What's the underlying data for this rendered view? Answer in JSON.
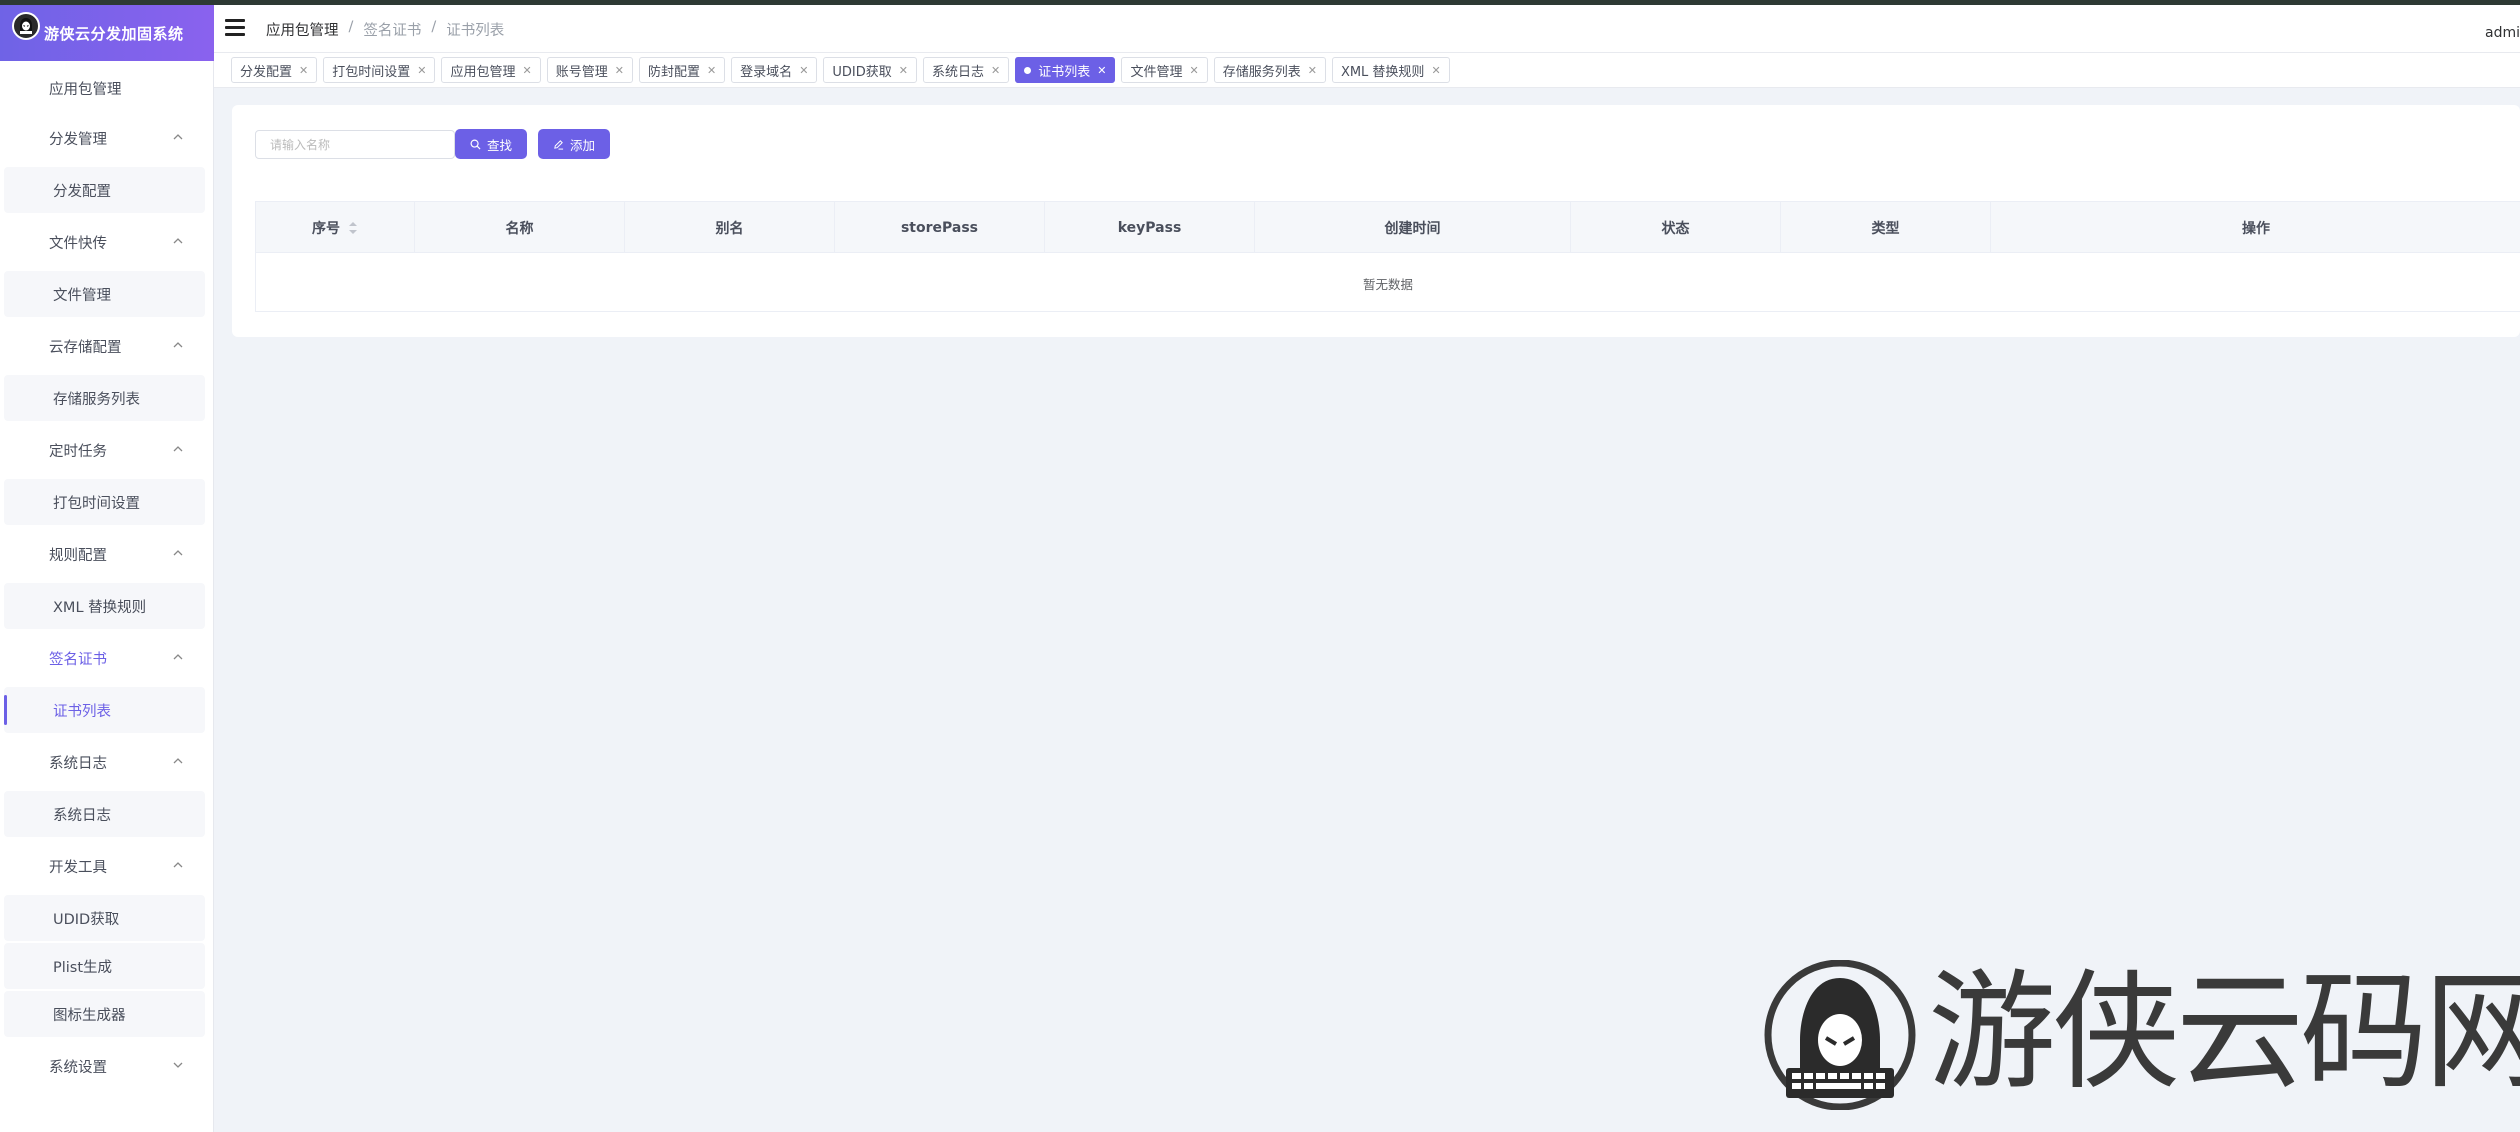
{
  "app": {
    "title": "游侠云分发加固系统"
  },
  "header": {
    "breadcrumbs": [
      "应用包管理",
      "签名证书",
      "证书列表"
    ],
    "user": "admi"
  },
  "sidebar": {
    "items": [
      {
        "label": "应用包管理",
        "type": "item"
      },
      {
        "label": "分发管理",
        "type": "group"
      },
      {
        "label": "分发配置",
        "type": "sub"
      },
      {
        "label": "文件快传",
        "type": "group"
      },
      {
        "label": "文件管理",
        "type": "sub"
      },
      {
        "label": "云存储配置",
        "type": "group"
      },
      {
        "label": "存储服务列表",
        "type": "sub"
      },
      {
        "label": "定时任务",
        "type": "group"
      },
      {
        "label": "打包时间设置",
        "type": "sub"
      },
      {
        "label": "规则配置",
        "type": "group"
      },
      {
        "label": "XML 替换规则",
        "type": "sub"
      },
      {
        "label": "签名证书",
        "type": "group",
        "active": true
      },
      {
        "label": "证书列表",
        "type": "sub",
        "active": true
      },
      {
        "label": "系统日志",
        "type": "group"
      },
      {
        "label": "系统日志",
        "type": "sub"
      },
      {
        "label": "开发工具",
        "type": "group"
      },
      {
        "label": "UDID获取",
        "type": "sub"
      },
      {
        "label": "Plist生成",
        "type": "sub"
      },
      {
        "label": "图标生成器",
        "type": "sub"
      },
      {
        "label": "系统设置",
        "type": "group",
        "collapsed": true
      }
    ]
  },
  "tabs": [
    {
      "label": "分发配置"
    },
    {
      "label": "打包时间设置"
    },
    {
      "label": "应用包管理"
    },
    {
      "label": "账号管理"
    },
    {
      "label": "防封配置"
    },
    {
      "label": "登录域名"
    },
    {
      "label": "UDID获取"
    },
    {
      "label": "系统日志"
    },
    {
      "label": "证书列表",
      "active": true
    },
    {
      "label": "文件管理"
    },
    {
      "label": "存储服务列表"
    },
    {
      "label": "XML 替换规则"
    }
  ],
  "toolbar": {
    "search_placeholder": "请输入名称",
    "find_label": "查找",
    "add_label": "添加"
  },
  "table": {
    "columns": [
      "序号",
      "名称",
      "别名",
      "storePass",
      "keyPass",
      "创建时间",
      "状态",
      "类型",
      "操作"
    ],
    "empty_text": "暂无数据"
  },
  "watermark": {
    "text": "游侠云码网"
  },
  "colors": {
    "accent": "#6c60e6",
    "background": "#f0f3f8"
  }
}
